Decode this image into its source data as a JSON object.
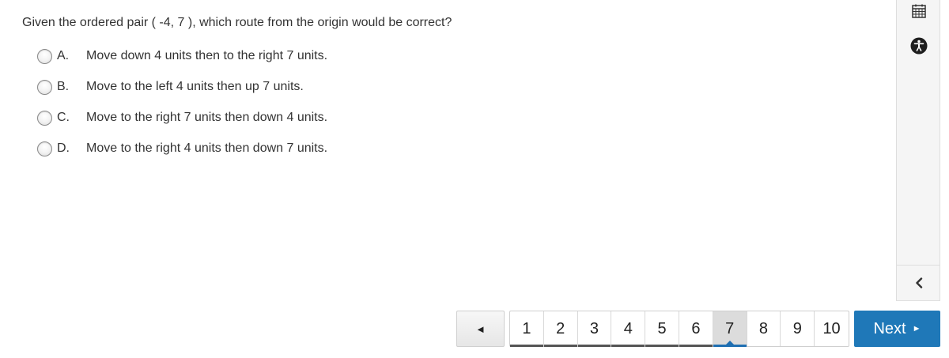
{
  "question": {
    "text": "Given the ordered pair ( -4, 7 ), which route from the origin would be correct?"
  },
  "options": [
    {
      "letter": "A.",
      "text": "Move down 4 units then to the right 7 units."
    },
    {
      "letter": "B.",
      "text": "Move to the left 4 units then up 7 units."
    },
    {
      "letter": "C.",
      "text": "Move to the right 7 units then down 4 units."
    },
    {
      "letter": "D.",
      "text": "Move to the right 4 units then down 7 units."
    }
  ],
  "sidebar": {
    "icons": [
      "calculator-icon",
      "accessibility-icon",
      "chevron-left-icon"
    ]
  },
  "navigation": {
    "prev_label": "◄",
    "pages": [
      "1",
      "2",
      "3",
      "4",
      "5",
      "6",
      "7",
      "8",
      "9",
      "10"
    ],
    "current_page": "7",
    "next_label": "Next",
    "next_arrow": "►"
  },
  "colors": {
    "accent": "#1f78b8",
    "text": "#333333",
    "visited_underline": "#555555"
  }
}
